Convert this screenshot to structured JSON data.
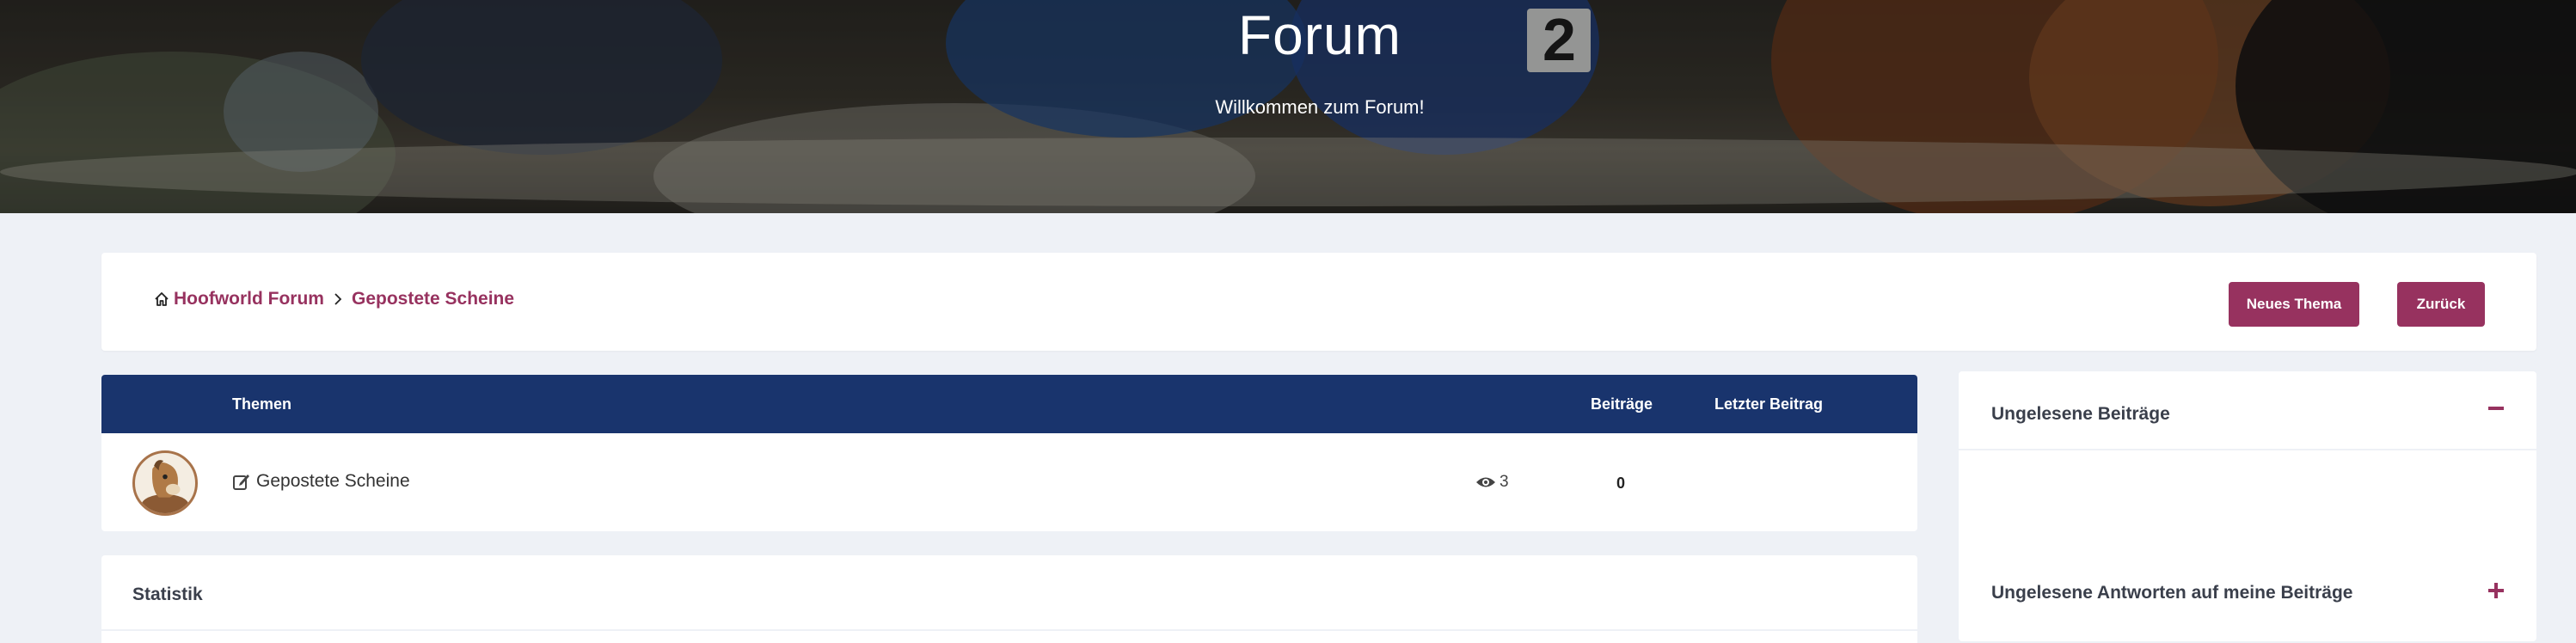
{
  "hero": {
    "title": "Forum",
    "subtitle": "Willkommen zum Forum!"
  },
  "breadcrumb": {
    "items": [
      "Hoofworld Forum",
      "Gepostete Scheine"
    ]
  },
  "buttons": {
    "new_topic": "Neues Thema",
    "back": "Zurück"
  },
  "topics_table": {
    "headers": {
      "topic": "Themen",
      "posts": "Beiträge",
      "last_post": "Letzter Beitrag"
    },
    "rows": [
      {
        "title": "Gepostete Scheine",
        "views": "3",
        "posts": "0",
        "last_post": ""
      }
    ]
  },
  "stats": {
    "title": "Statistik"
  },
  "sidebar": {
    "widgets": [
      {
        "title": "Ungelesene Beiträge",
        "toggle": "collapse-icon"
      },
      {
        "title": "Ungelesene Antworten auf meine Beiträge",
        "toggle": "expand-icon"
      }
    ]
  },
  "colors": {
    "accent": "#97325f",
    "table_header": "#19346d",
    "background": "#eef1f6"
  }
}
